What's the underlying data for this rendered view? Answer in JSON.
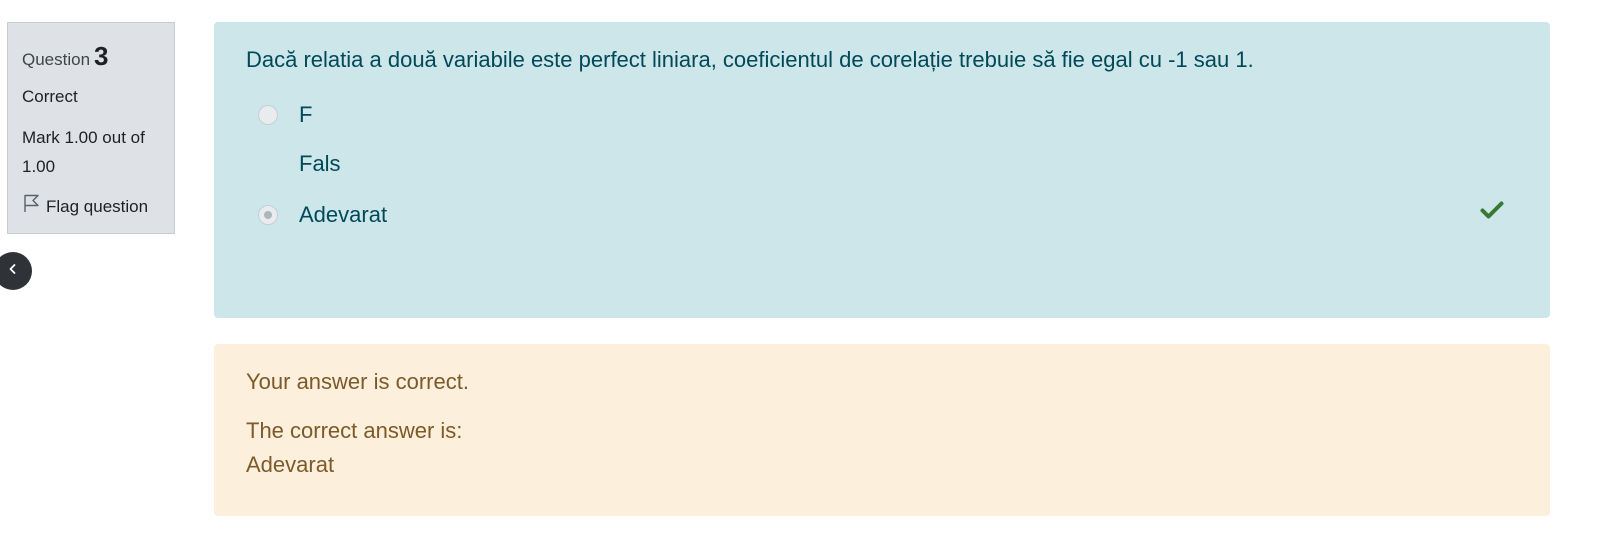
{
  "info": {
    "question_label": "Question",
    "question_number": "3",
    "state": "Correct",
    "grade": "Mark 1.00 out of 1.00",
    "flag_label": "Flag question"
  },
  "question": {
    "text": "Dacă relatia a două variabile este perfect liniara, coeficientul de corelație trebuie să fie egal cu -1 sau 1.",
    "answers": [
      {
        "label": "F",
        "sub": "Fals",
        "selected": false
      },
      {
        "label": "Adevarat",
        "selected": true,
        "mark": "correct"
      }
    ]
  },
  "outcome": {
    "feedback": "Your answer is correct.",
    "rightanswer_label": "The correct answer is:",
    "rightanswer_value": "Adevarat"
  },
  "colors": {
    "formulation_bg": "#cce6ea",
    "outcome_bg": "#fcefdc",
    "info_bg": "#dee2e6",
    "correct_check": "#357a32"
  }
}
